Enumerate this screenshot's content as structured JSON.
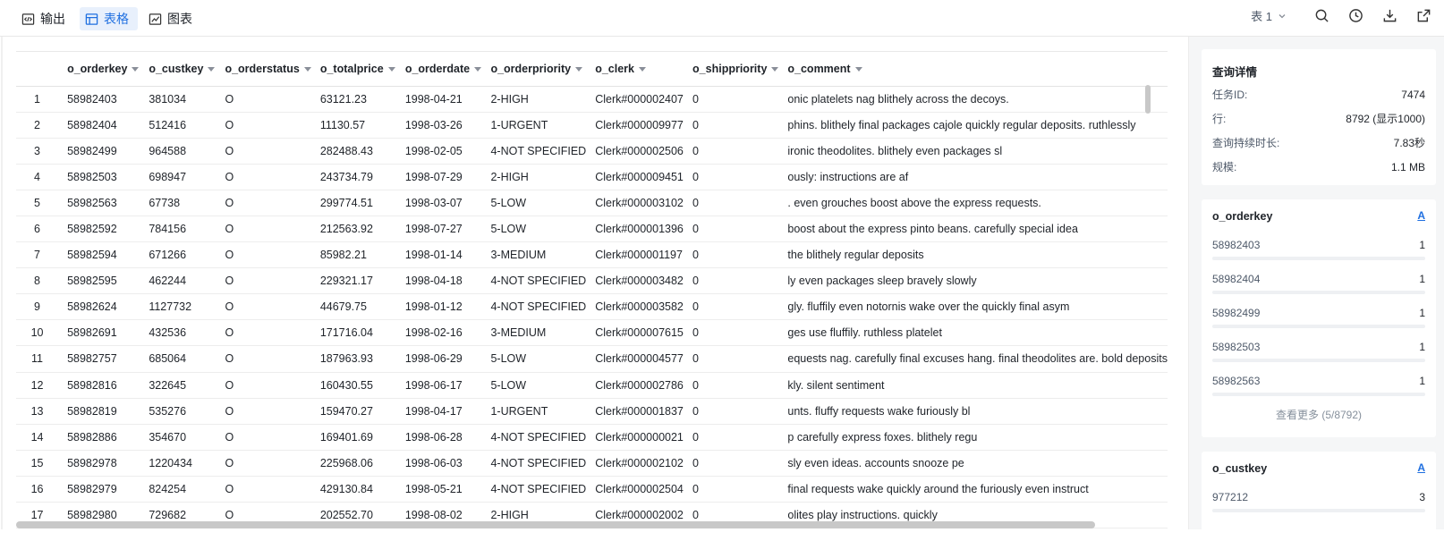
{
  "toolbar": {
    "tabs": [
      {
        "label": "输出",
        "icon": "code-icon"
      },
      {
        "label": "表格",
        "icon": "table-icon"
      },
      {
        "label": "图表",
        "icon": "chart-icon"
      }
    ],
    "table_select": "表 1"
  },
  "columns": [
    "o_orderkey",
    "o_custkey",
    "o_orderstatus",
    "o_totalprice",
    "o_orderdate",
    "o_orderpriority",
    "o_clerk",
    "o_shippriority",
    "o_comment"
  ],
  "rows": [
    [
      "1",
      "58982403",
      "381034",
      "O",
      "63121.23",
      "1998-04-21",
      "2-HIGH",
      "Clerk#000002407",
      "0",
      "onic platelets nag blithely across the decoys."
    ],
    [
      "2",
      "58982404",
      "512416",
      "O",
      "11130.57",
      "1998-03-26",
      "1-URGENT",
      "Clerk#000009977",
      "0",
      "phins. blithely final packages cajole quickly regular deposits. ruthlessly"
    ],
    [
      "3",
      "58982499",
      "964588",
      "O",
      "282488.43",
      "1998-02-05",
      "4-NOT SPECIFIED",
      "Clerk#000002506",
      "0",
      " ironic theodolites. blithely even packages sl"
    ],
    [
      "4",
      "58982503",
      "698947",
      "O",
      "243734.79",
      "1998-07-29",
      "2-HIGH",
      "Clerk#000009451",
      "0",
      "ously: instructions are af"
    ],
    [
      "5",
      "58982563",
      "67738",
      "O",
      "299774.51",
      "1998-03-07",
      "5-LOW",
      "Clerk#000003102",
      "0",
      ". even grouches boost above the express requests."
    ],
    [
      "6",
      "58982592",
      "784156",
      "O",
      "212563.92",
      "1998-07-27",
      "5-LOW",
      "Clerk#000001396",
      "0",
      " boost about the express pinto beans. carefully special idea"
    ],
    [
      "7",
      "58982594",
      "671266",
      "O",
      "85982.21",
      "1998-01-14",
      "3-MEDIUM",
      "Clerk#000001197",
      "0",
      " the blithely regular deposits"
    ],
    [
      "8",
      "58982595",
      "462244",
      "O",
      "229321.17",
      "1998-04-18",
      "4-NOT SPECIFIED",
      "Clerk#000003482",
      "0",
      "ly even packages sleep bravely slowly"
    ],
    [
      "9",
      "58982624",
      "1127732",
      "O",
      "44679.75",
      "1998-01-12",
      "4-NOT SPECIFIED",
      "Clerk#000003582",
      "0",
      "gly. fluffily even notornis wake over the quickly final asym"
    ],
    [
      "10",
      "58982691",
      "432536",
      "O",
      "171716.04",
      "1998-02-16",
      "3-MEDIUM",
      "Clerk#000007615",
      "0",
      "ges use fluffily. ruthless platelet"
    ],
    [
      "11",
      "58982757",
      "685064",
      "O",
      "187963.93",
      "1998-06-29",
      "5-LOW",
      "Clerk#000004577",
      "0",
      "equests nag. carefully final excuses hang. final theodolites are. bold deposits"
    ],
    [
      "12",
      "58982816",
      "322645",
      "O",
      "160430.55",
      "1998-06-17",
      "5-LOW",
      "Clerk#000002786",
      "0",
      "kly. silent sentiment"
    ],
    [
      "13",
      "58982819",
      "535276",
      "O",
      "159470.27",
      "1998-04-17",
      "1-URGENT",
      "Clerk#000001837",
      "0",
      "unts. fluffy requests wake furiously bl"
    ],
    [
      "14",
      "58982886",
      "354670",
      "O",
      "169401.69",
      "1998-06-28",
      "4-NOT SPECIFIED",
      "Clerk#000000021",
      "0",
      "p carefully express foxes. blithely regu"
    ],
    [
      "15",
      "58982978",
      "1220434",
      "O",
      "225968.06",
      "1998-06-03",
      "4-NOT SPECIFIED",
      "Clerk#000002102",
      "0",
      "sly even ideas. accounts snooze pe"
    ],
    [
      "16",
      "58982979",
      "824254",
      "O",
      "429130.84",
      "1998-05-21",
      "4-NOT SPECIFIED",
      "Clerk#000002504",
      "0",
      " final requests wake quickly around the furiously even instruct"
    ],
    [
      "17",
      "58982980",
      "729682",
      "O",
      "202552.70",
      "1998-08-02",
      "2-HIGH",
      "Clerk#000002002",
      "0",
      "olites play instructions. quickly"
    ]
  ],
  "details": {
    "title": "查询详情",
    "items": [
      {
        "k": "任务ID:",
        "v": "7474"
      },
      {
        "k": "行:",
        "v": "8792 (显示1000)"
      },
      {
        "k": "查询持续时长:",
        "v": "7.83秒"
      },
      {
        "k": "规模:",
        "v": "1.1 MB"
      }
    ]
  },
  "col_stats": [
    {
      "title": "o_orderkey",
      "sort": "A",
      "items": [
        {
          "label": "58982403",
          "count": "1"
        },
        {
          "label": "58982404",
          "count": "1"
        },
        {
          "label": "58982499",
          "count": "1"
        },
        {
          "label": "58982503",
          "count": "1"
        },
        {
          "label": "58982563",
          "count": "1"
        }
      ],
      "more": "查看更多 (5/8792)"
    },
    {
      "title": "o_custkey",
      "sort": "A",
      "items": [
        {
          "label": "977212",
          "count": "3"
        }
      ]
    }
  ]
}
